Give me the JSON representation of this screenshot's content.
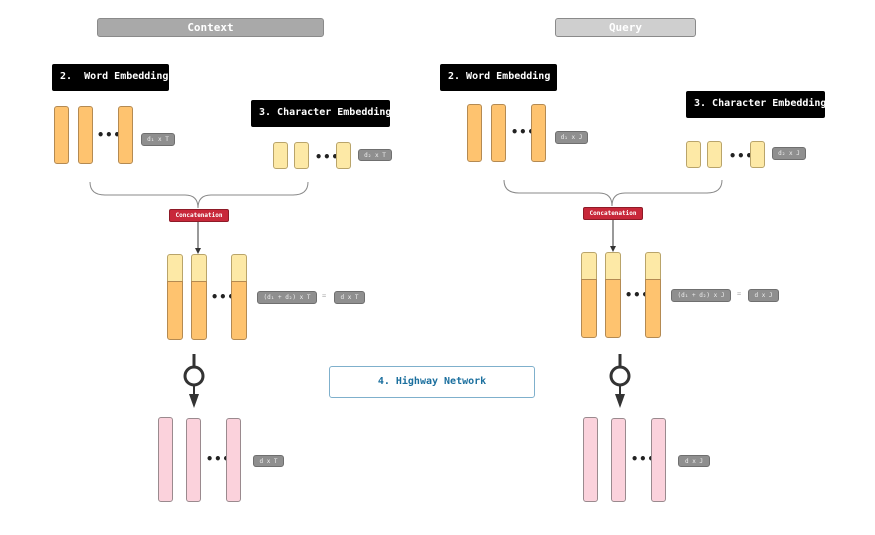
{
  "headers": {
    "context": "Context",
    "query": "Query"
  },
  "context": {
    "word_embedding_label": "2.  Word Embedding",
    "char_embedding_label": "3. Character Embedding",
    "word_dim": "d₁ x T",
    "char_dim": "d₂ x T",
    "concat_label": "Concatenation",
    "concat_dim": "(d₁ + d₂) x T",
    "equals": "=",
    "combined_dim": "d x T",
    "highway_dim": "d x T",
    "dots": "•••"
  },
  "query": {
    "word_embedding_label": "2. Word Embedding",
    "char_embedding_label": "3. Character Embedding",
    "word_dim": "d₁ x J",
    "char_dim": "d₂ x J",
    "concat_label": "Concatenation",
    "concat_dim": "(d₁ + d₂) x J",
    "equals": "=",
    "combined_dim": "d x J",
    "highway_dim": "d x J",
    "dots": "•••"
  },
  "highway_network_label": "4. Highway Network",
  "colors": {
    "word_vector": "#fec36f",
    "char_vector": "#fde9a6",
    "highway_vector": "#fbd2dc",
    "concat_badge": "#c8283a",
    "highway_label": "#1b6f9e"
  }
}
